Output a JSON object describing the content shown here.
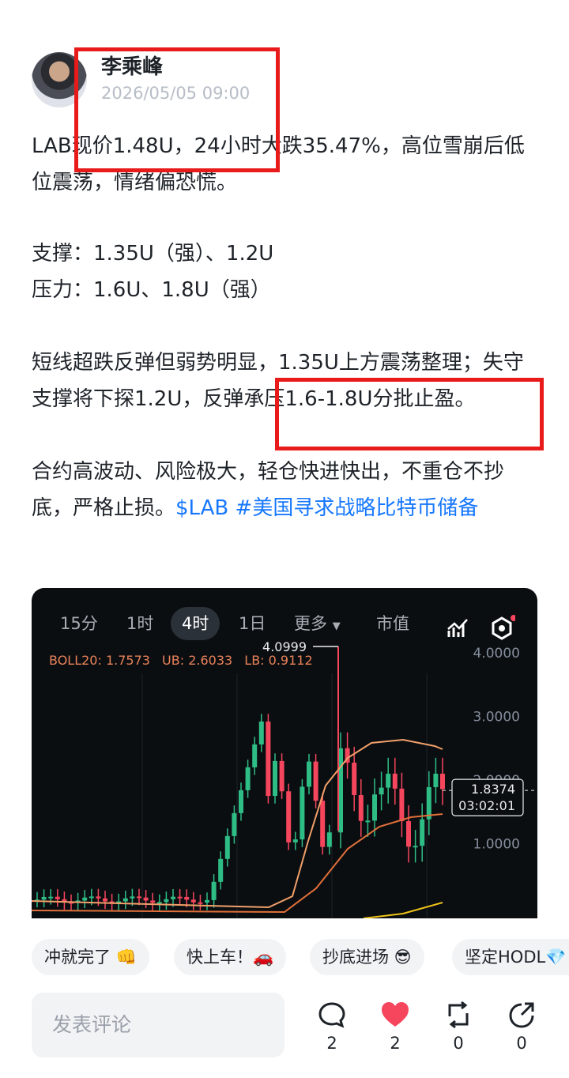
{
  "post": {
    "author": "李乘峰",
    "time": "2026/05/05 09:00",
    "paragraphs": [
      "LAB现价1.48U，24小时大跌35.47%，高位雪崩后低位震荡，情绪偏恐慌。",
      "支撑：1.35U（强）、1.2U",
      "压力：1.6U、1.8U（强）",
      "短线超跌反弹但弱势明显，1.35U上方震荡整理；失守支撑将下探1.2U，反弹承压1.6-1.8U分批止盈。",
      "合约高波动、风险极大，轻仓快进快出，不重仓不抄底，严格止损。"
    ],
    "tags": [
      "$LAB",
      "#美国寻求战略比特币储备"
    ]
  },
  "chart": {
    "timeframes": [
      "15分",
      "1时",
      "4时",
      "1日",
      "更多",
      "市值"
    ],
    "active_timeframe": "4时",
    "boll": {
      "label": "BOLL20: 1.7573",
      "ub": "UB: 2.6033",
      "lb": "LB: 0.9112"
    },
    "high_label": "4.0999",
    "y_ticks": [
      "4.0000",
      "3.0000",
      "2.0000",
      "1.0000"
    ],
    "current_price": "1.8374",
    "countdown": "03:02:01",
    "colors": {
      "up": "#2ebd85",
      "down": "#f6465d",
      "ub": "#f0a06a",
      "mid": "#f0c419",
      "lb": "#e0703a"
    }
  },
  "reactions": [
    "冲就完了 👊",
    "快上车！🚗",
    "抄底进场 😎",
    "坚定HODL💎"
  ],
  "comment_placeholder": "发表评论",
  "actions": {
    "comments": "2",
    "likes": "2",
    "reposts": "0",
    "shares": "0"
  }
}
